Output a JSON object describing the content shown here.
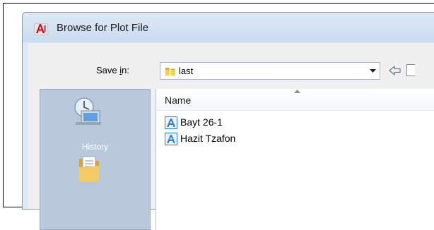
{
  "window": {
    "title": "Browse for Plot File",
    "app_icon": "autocad-icon"
  },
  "toolbar": {
    "save_in_label": "Save in:",
    "save_in_value": "last",
    "folder_icon": "folder-icon",
    "dropdown_icon": "chevron-down-icon",
    "back_icon": "back-arrow-icon"
  },
  "places": {
    "items": [
      {
        "label": "History",
        "icon": "history-icon"
      },
      {
        "label": "",
        "icon": "documents-folder-icon"
      }
    ]
  },
  "file_list": {
    "columns": [
      {
        "label": "Name",
        "sorted": "ascending"
      }
    ],
    "rows": [
      {
        "name": "Bayt 26-1",
        "icon": "plot-file-icon"
      },
      {
        "name": "Hazit Tzafon",
        "icon": "plot-file-icon"
      }
    ]
  },
  "colors": {
    "accent": "#2f7fd6",
    "title_bar": "#cbdcef",
    "places_bg": "#b9c9db"
  }
}
